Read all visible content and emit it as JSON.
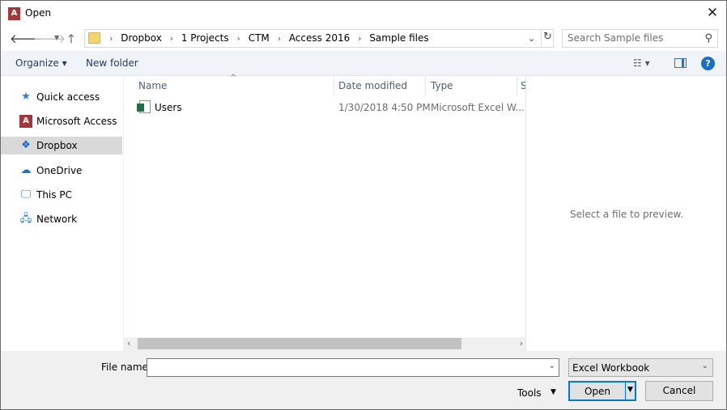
{
  "window": {
    "title": "Open",
    "app_icon_letter": "A",
    "close_glyph": "✕"
  },
  "navigation": {
    "back_icon": "arrow-left-icon",
    "forward_icon": "arrow-right-icon",
    "up_icon": "arrow-up-icon"
  },
  "address_bar": {
    "breadcrumbs": [
      "Dropbox",
      "1 Projects",
      "CTM",
      "Access 2016",
      "Sample files"
    ]
  },
  "search": {
    "placeholder": "Search Sample files"
  },
  "toolbar": {
    "organize_label": "Organize ▾",
    "new_folder_label": "New folder",
    "help_label": "?"
  },
  "sidebar": {
    "items": [
      {
        "label": "Quick access",
        "icon": "star-icon",
        "selected": false
      },
      {
        "label": "Microsoft Access",
        "icon": "access-icon",
        "selected": false
      },
      {
        "label": "Dropbox",
        "icon": "dropbox-icon",
        "selected": true
      },
      {
        "label": "OneDrive",
        "icon": "cloud-icon",
        "selected": false
      },
      {
        "label": "This PC",
        "icon": "monitor-icon",
        "selected": false
      },
      {
        "label": "Network",
        "icon": "network-icon",
        "selected": false
      }
    ]
  },
  "file_list": {
    "columns": [
      "Name",
      "Date modified",
      "Type",
      "S"
    ],
    "rows": [
      {
        "name": "Users",
        "date_modified": "1/30/2018 4:50 PM",
        "type": "Microsoft Excel W..."
      }
    ]
  },
  "preview": {
    "message": "Select a file to preview."
  },
  "bottom": {
    "file_name_label": "File name:",
    "file_name_value": "",
    "file_type_filter": "Excel Workbook",
    "tools_label": "Tools",
    "open_label": "Open",
    "cancel_label": "Cancel"
  },
  "colors": {
    "accent": "#0078d7",
    "selected_nav": "#d9d9d9",
    "toolbar_bg": "#f0f4f9",
    "bottom_bg": "#f0f0f0"
  }
}
